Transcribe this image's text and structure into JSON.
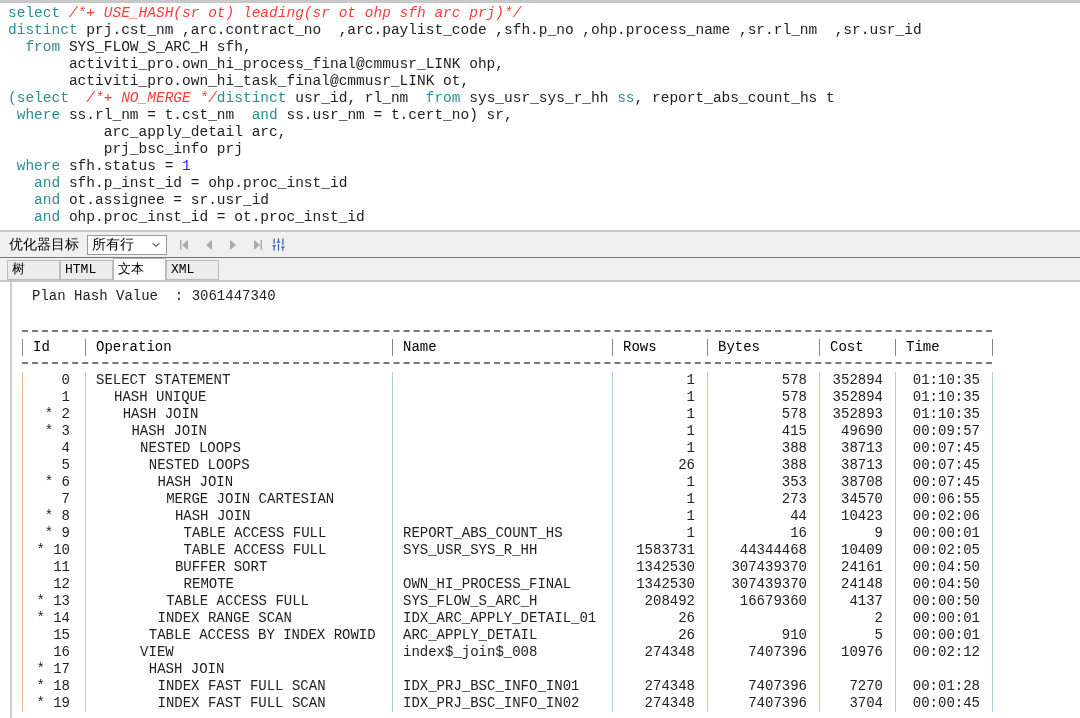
{
  "editor": {
    "lines": [
      [
        {
          "kind": "keyword",
          "text": "select"
        },
        {
          "kind": "hint",
          "text": " /*+ USE_HASH(sr ot) leading(sr ot ohp sfh arc prj)*/"
        }
      ],
      [
        {
          "kind": "keyword",
          "text": "distinct"
        },
        {
          "kind": "text",
          "text": " prj.cst_nm ,arc.contract_no  ,arc.paylist_code ,sfh.p_no ,ohp.process_name ,sr.rl_nm  ,sr.usr_id"
        }
      ],
      [
        {
          "kind": "keyword",
          "text": "  from"
        },
        {
          "kind": "text",
          "text": " SYS_FLOW_S_ARC_H sfh,"
        }
      ],
      [
        {
          "kind": "text",
          "text": "       activiti_pro.own_hi_process_final@cmmusr_LINK ohp,"
        }
      ],
      [
        {
          "kind": "text",
          "text": "       activiti_pro.own_hi_task_final@cmmusr_LINK ot,"
        }
      ],
      [
        {
          "kind": "keyword",
          "text": "(select"
        },
        {
          "kind": "hint",
          "text": "  /*+ NO_MERGE */"
        },
        {
          "kind": "keyword",
          "text": "distinct"
        },
        {
          "kind": "text",
          "text": " usr_id, rl_nm  "
        },
        {
          "kind": "keyword",
          "text": "from"
        },
        {
          "kind": "text",
          "text": " sys_usr_sys_r_hh "
        },
        {
          "kind": "keyword",
          "text": "ss"
        },
        {
          "kind": "text",
          "text": ", report_abs_count_hs t"
        }
      ],
      [
        {
          "kind": "keyword",
          "text": " where"
        },
        {
          "kind": "text",
          "text": " ss.rl_nm = t.cst_nm  "
        },
        {
          "kind": "keyword",
          "text": "and"
        },
        {
          "kind": "text",
          "text": " ss.usr_nm = t.cert_no) sr,"
        }
      ],
      [
        {
          "kind": "text",
          "text": "           arc_apply_detail arc,"
        }
      ],
      [
        {
          "kind": "text",
          "text": "           prj_bsc_info prj"
        }
      ],
      [
        {
          "kind": "keyword",
          "text": " where"
        },
        {
          "kind": "text",
          "text": " sfh.status = "
        },
        {
          "kind": "number",
          "text": "1"
        }
      ],
      [
        {
          "kind": "keyword",
          "text": "   and"
        },
        {
          "kind": "text",
          "text": " sfh.p_inst_id = ohp.proc_inst_id"
        }
      ],
      [
        {
          "kind": "keyword",
          "text": "   and"
        },
        {
          "kind": "text",
          "text": " ot.assignee = sr.usr_id"
        }
      ],
      [
        {
          "kind": "keyword",
          "text": "   and"
        },
        {
          "kind": "text",
          "text": " ohp.proc_inst_id = ot.proc_inst_id"
        }
      ]
    ]
  },
  "toolbar": {
    "label": "优化器目标",
    "select_value": "所有行"
  },
  "tabs": [
    {
      "label": "树",
      "selected": false
    },
    {
      "label": "HTML",
      "selected": false
    },
    {
      "label": "文本",
      "selected": true
    },
    {
      "label": "XML",
      "selected": false
    }
  ],
  "plan": {
    "hash_line": "Plan Hash Value  : 3061447340",
    "columns": [
      "Id",
      "Operation",
      "Name",
      "Rows",
      "Bytes",
      "Cost",
      "Time"
    ],
    "rows": [
      {
        "id": "0",
        "operation": "SELECT STATEMENT",
        "rows": "1",
        "bytes": "578",
        "cost": "352894",
        "time": "01:10:35",
        "children": [
          {
            "id": "1",
            "operation": "HASH UNIQUE",
            "rows": "1",
            "bytes": "578",
            "cost": "352894",
            "time": "01:10:35",
            "children": [
              {
                "id": "* 2",
                "operation": "HASH JOIN",
                "rows": "1",
                "bytes": "578",
                "cost": "352893",
                "time": "01:10:35",
                "children": [
                  {
                    "id": "* 3",
                    "operation": "HASH JOIN",
                    "rows": "1",
                    "bytes": "415",
                    "cost": "49690",
                    "time": "00:09:57",
                    "children": [
                      {
                        "id": "4",
                        "operation": "NESTED LOOPS",
                        "rows": "1",
                        "bytes": "388",
                        "cost": "38713",
                        "time": "00:07:45",
                        "children": [
                          {
                            "id": "5",
                            "operation": "NESTED LOOPS",
                            "rows": "26",
                            "bytes": "388",
                            "cost": "38713",
                            "time": "00:07:45",
                            "children": [
                              {
                                "id": "* 6",
                                "operation": "HASH JOIN",
                                "rows": "1",
                                "bytes": "353",
                                "cost": "38708",
                                "time": "00:07:45",
                                "children": [
                                  {
                                    "id": "7",
                                    "operation": "MERGE JOIN CARTESIAN",
                                    "rows": "1",
                                    "bytes": "273",
                                    "cost": "34570",
                                    "time": "00:06:55",
                                    "children": [
                                      {
                                        "id": "* 8",
                                        "operation": "HASH JOIN",
                                        "rows": "1",
                                        "bytes": "44",
                                        "cost": "10423",
                                        "time": "00:02:06",
                                        "children": [
                                          {
                                            "id": "* 9",
                                            "operation": "TABLE ACCESS FULL",
                                            "name": "REPORT_ABS_COUNT_HS",
                                            "rows": "1",
                                            "bytes": "16",
                                            "cost": "9",
                                            "time": "00:00:01"
                                          },
                                          {
                                            "id": "* 10",
                                            "operation": "TABLE ACCESS FULL",
                                            "name": "SYS_USR_SYS_R_HH",
                                            "rows": "1583731",
                                            "bytes": "44344468",
                                            "cost": "10409",
                                            "time": "00:02:05"
                                          }
                                        ]
                                      },
                                      {
                                        "id": "11",
                                        "operation": "BUFFER SORT",
                                        "rows": "1342530",
                                        "bytes": "307439370",
                                        "cost": "24161",
                                        "time": "00:04:50",
                                        "children": [
                                          {
                                            "id": "12",
                                            "operation": "REMOTE",
                                            "name": "OWN_HI_PROCESS_FINAL",
                                            "rows": "1342530",
                                            "bytes": "307439370",
                                            "cost": "24148",
                                            "time": "00:04:50"
                                          }
                                        ]
                                      }
                                    ]
                                  },
                                  {
                                    "id": "* 13",
                                    "operation": "TABLE ACCESS FULL",
                                    "name": "SYS_FLOW_S_ARC_H",
                                    "rows": "208492",
                                    "bytes": "16679360",
                                    "cost": "4137",
                                    "time": "00:00:50"
                                  }
                                ]
                              },
                              {
                                "id": "* 14",
                                "operation": "INDEX RANGE SCAN",
                                "name": "IDX_ARC_APPLY_DETAIL_01",
                                "rows": "26",
                                "cost": "2",
                                "time": "00:00:01"
                              }
                            ]
                          },
                          {
                            "id": "15",
                            "operation": "TABLE ACCESS BY INDEX ROWID",
                            "name": "ARC_APPLY_DETAIL",
                            "rows": "26",
                            "bytes": "910",
                            "cost": "5",
                            "time": "00:00:01"
                          }
                        ]
                      },
                      {
                        "id": "16",
                        "operation": "VIEW",
                        "name": "index$_join$_008",
                        "rows": "274348",
                        "bytes": "7407396",
                        "cost": "10976",
                        "time": "00:02:12",
                        "children": [
                          {
                            "id": "* 17",
                            "operation": "HASH JOIN",
                            "children": [
                              {
                                "id": "* 18",
                                "operation": "INDEX FAST FULL SCAN",
                                "name": "IDX_PRJ_BSC_INFO_IN01",
                                "rows": "274348",
                                "bytes": "7407396",
                                "cost": "7270",
                                "time": "00:01:28"
                              },
                              {
                                "id": "* 19",
                                "operation": "INDEX FAST FULL SCAN",
                                "name": "IDX_PRJ_BSC_INFO_IN02",
                                "rows": "274348",
                                "bytes": "7407396",
                                "cost": "3704",
                                "time": "00:00:45"
                              }
                            ]
                          }
                        ]
                      }
                    ]
                  }
                ]
              }
            ]
          }
        ]
      }
    ]
  }
}
